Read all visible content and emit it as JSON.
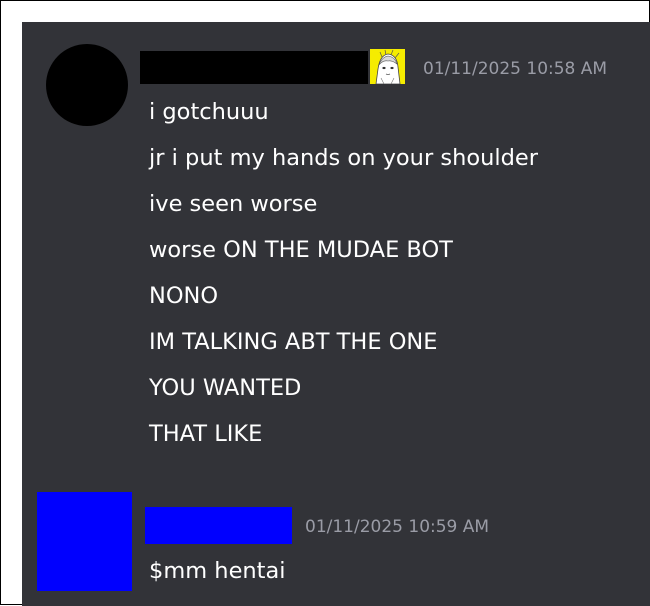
{
  "messages": [
    {
      "timestamp": "01/11/2025 10:58 AM",
      "avatar_icon": "avatar-redacted-circle",
      "badge_icon": "anime-character-badge",
      "lines": [
        "i gotchuuu",
        "jr i put my hands on your shoulder",
        "ive seen worse",
        "worse ON THE MUDAE BOT",
        "NONO",
        "IM TALKING ABT THE ONE",
        "YOU WANTED",
        "THAT LIKE"
      ]
    },
    {
      "timestamp": "01/11/2025 10:59 AM",
      "avatar_icon": "avatar-redacted-square",
      "lines": [
        "$mm hentai"
      ]
    }
  ],
  "colors": {
    "background": "#323338",
    "timestamp": "#9a9ca6",
    "text": "#ffffff",
    "redact_black": "#000000",
    "redact_blue": "#0000ff",
    "badge_yellow": "#f5ec00"
  }
}
